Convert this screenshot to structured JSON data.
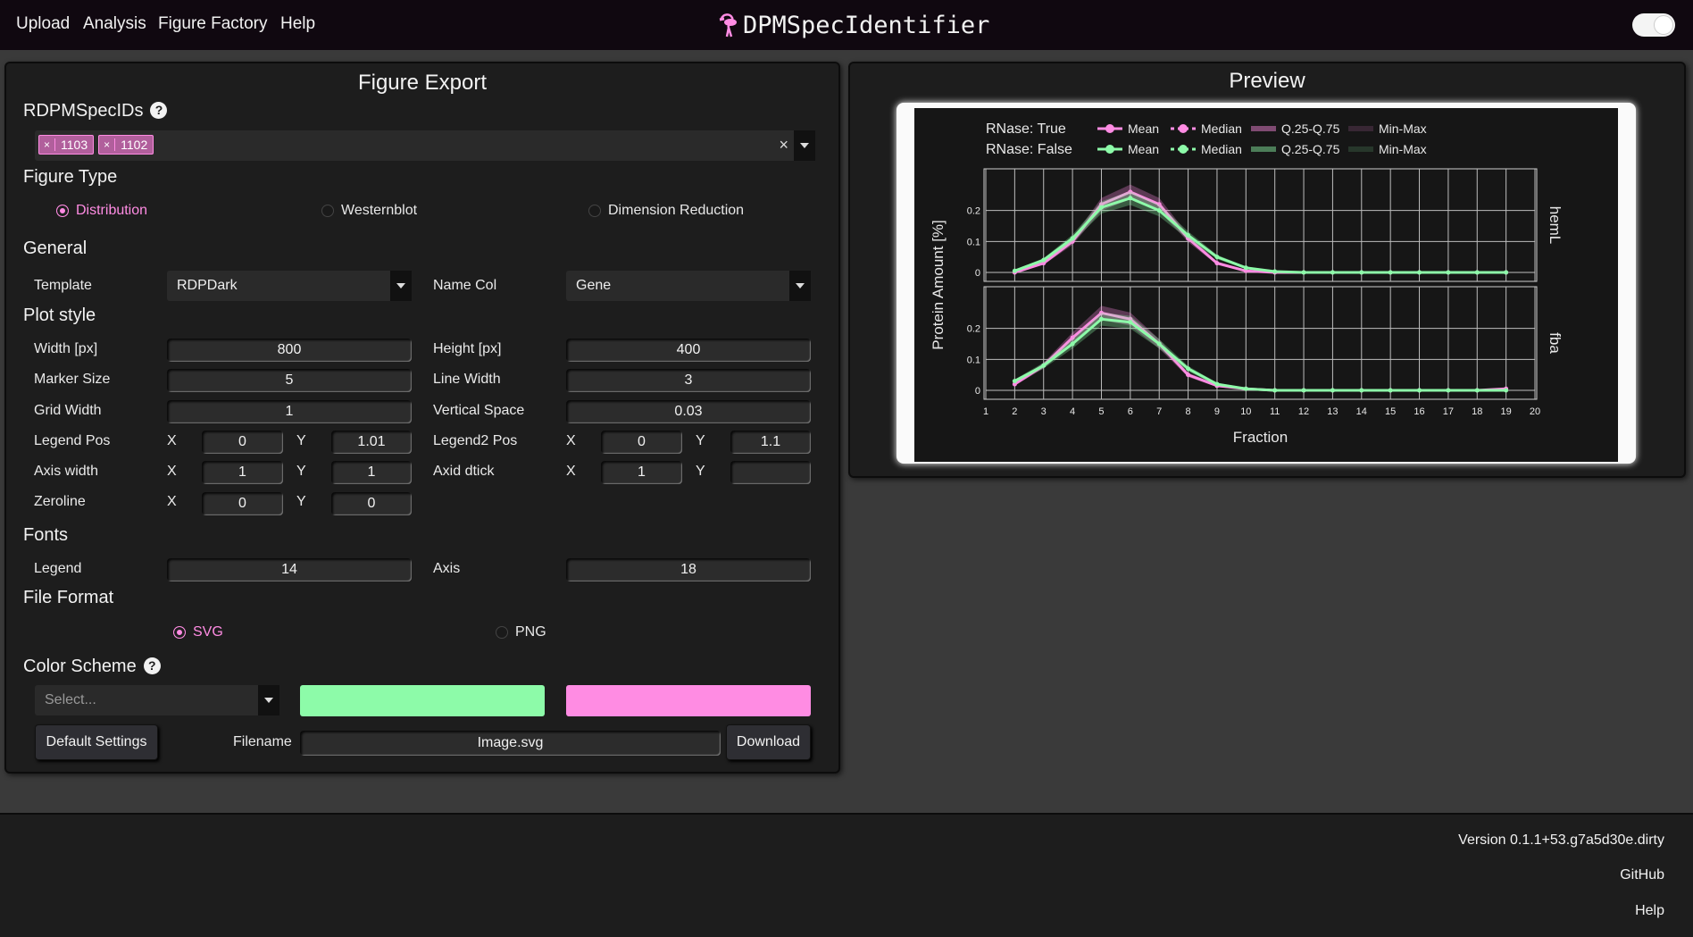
{
  "nav": {
    "items": [
      "Upload",
      "Analysis",
      "Figure Factory",
      "Help"
    ],
    "brand": "DPMSpecIdentifier"
  },
  "export": {
    "title": "Figure Export",
    "ids_label": "RDPMSpecIDs",
    "selected_ids": [
      "1103",
      "1102"
    ],
    "clear_symbol": "×",
    "figure_type_label": "Figure Type",
    "figure_types": [
      {
        "label": "Distribution",
        "selected": true
      },
      {
        "label": "Westernblot",
        "selected": false
      },
      {
        "label": "Dimension Reduction",
        "selected": false
      }
    ],
    "general_label": "General",
    "template_label": "Template",
    "template_value": "RDPDark",
    "namecol_label": "Name Col",
    "namecol_value": "Gene",
    "plotstyle_label": "Plot style",
    "width_label": "Width [px]",
    "width_value": "800",
    "height_label": "Height [px]",
    "height_value": "400",
    "marker_label": "Marker Size",
    "marker_value": "5",
    "linewidth_label": "Line Width",
    "linewidth_value": "3",
    "grid_label": "Grid Width",
    "grid_value": "1",
    "vspace_label": "Vertical Space",
    "vspace_value": "0.03",
    "legendpos_label": "Legend Pos",
    "legendpos_x": "0",
    "legendpos_y": "1.01",
    "legend2pos_label": "Legend2 Pos",
    "legend2pos_x": "0",
    "legend2pos_y": "1.1",
    "axiswidth_label": "Axis width",
    "axiswidth_x": "1",
    "axiswidth_y": "1",
    "dtick_label": "Axid dtick",
    "dtick_x": "1",
    "dtick_y": "",
    "zeroline_label": "Zeroline",
    "zeroline_x": "0",
    "zeroline_y": "0",
    "x_label": "X",
    "y_label": "Y",
    "fonts_label": "Fonts",
    "legend_font_label": "Legend",
    "legend_font_value": "14",
    "axis_font_label": "Axis",
    "axis_font_value": "18",
    "fileformat_label": "File Format",
    "formats": [
      {
        "label": "SVG",
        "selected": true
      },
      {
        "label": "PNG",
        "selected": false
      }
    ],
    "colorscheme_label": "Color Scheme",
    "color_select_placeholder": "Select...",
    "color_primary": "#8dfba9",
    "color_secondary": "#ff8ce3",
    "default_button": "Default Settings",
    "filename_label": "Filename",
    "filename_value": "Image.svg",
    "download_button": "Download"
  },
  "preview": {
    "title": "Preview"
  },
  "chart_data": {
    "type": "line",
    "xlabel": "Fraction",
    "ylabel": "Protein Amount [%]",
    "x_ticks": [
      "1",
      "2",
      "3",
      "4",
      "5",
      "6",
      "7",
      "8",
      "9",
      "10",
      "11",
      "12",
      "13",
      "14",
      "15",
      "16",
      "17",
      "18",
      "19",
      "20"
    ],
    "y_ticks": [
      "0",
      "0.1",
      "0.2"
    ],
    "ylim": [
      0,
      0.3
    ],
    "legend": [
      {
        "group": "RNase: True",
        "entries": [
          "Mean",
          "Median",
          "Q.25-Q.75",
          "Min-Max"
        ],
        "color": "#ff8ce3"
      },
      {
        "group": "RNase: False",
        "entries": [
          "Mean",
          "Median",
          "Q.25-Q.75",
          "Min-Max"
        ],
        "color": "#8dfba9"
      }
    ],
    "panels": [
      {
        "name": "hemL",
        "x": [
          2,
          3,
          4,
          5,
          6,
          7,
          8,
          9,
          10,
          11,
          12,
          13,
          14,
          15,
          16,
          17,
          18,
          19
        ],
        "series": [
          {
            "name": "RNase: True",
            "values": [
              0.0,
              0.03,
              0.1,
              0.22,
              0.26,
              0.22,
              0.11,
              0.03,
              0.005,
              0,
              0,
              0,
              0,
              0,
              0,
              0,
              0,
              0
            ]
          },
          {
            "name": "RNase: False",
            "values": [
              0.005,
              0.04,
              0.11,
              0.21,
              0.24,
              0.2,
              0.12,
              0.05,
              0.015,
              0.003,
              0,
              0,
              0,
              0,
              0,
              0,
              0,
              0
            ]
          }
        ]
      },
      {
        "name": "fba",
        "x": [
          2,
          3,
          4,
          5,
          6,
          7,
          8,
          9,
          10,
          11,
          12,
          13,
          14,
          15,
          16,
          17,
          18,
          19
        ],
        "series": [
          {
            "name": "RNase: True",
            "values": [
              0.02,
              0.08,
              0.17,
              0.25,
              0.23,
              0.15,
              0.05,
              0.015,
              0.005,
              0,
              0,
              0,
              0,
              0,
              0,
              0,
              0,
              0.005
            ]
          },
          {
            "name": "RNase: False",
            "values": [
              0.03,
              0.08,
              0.15,
              0.23,
              0.22,
              0.15,
              0.07,
              0.02,
              0.005,
              0,
              0,
              0,
              0,
              0,
              0,
              0,
              0,
              0
            ]
          }
        ]
      }
    ]
  },
  "footer": {
    "version": "Version 0.1.1+53.g7a5d30e.dirty",
    "github": "GitHub",
    "help": "Help"
  }
}
